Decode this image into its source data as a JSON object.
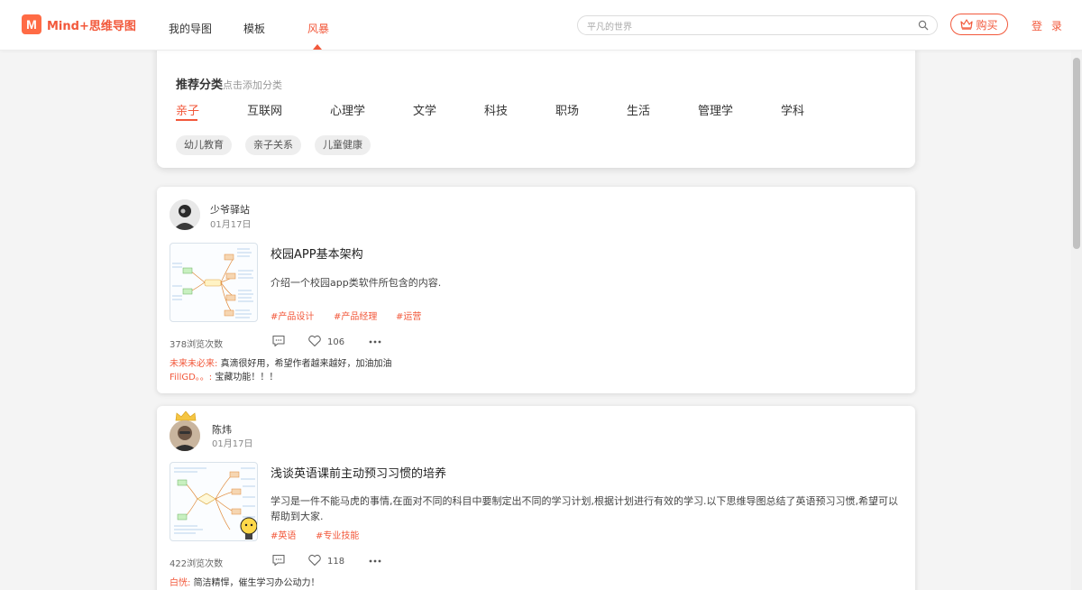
{
  "header": {
    "logo_text": "Mind+思维导图",
    "logo_mark": "M",
    "nav": [
      "我的导图",
      "模板",
      "风暴"
    ],
    "active_nav": "风暴",
    "search_placeholder": "平凡的世界",
    "buy_label": "购买",
    "login_label": "登 录",
    "brand_color": "#f2583b"
  },
  "categories": {
    "title": "推荐分类",
    "hint": "点击添加分类",
    "tabs": [
      "亲子",
      "互联网",
      "心理学",
      "文学",
      "科技",
      "职场",
      "生活",
      "管理学",
      "学科"
    ],
    "active_tab": "亲子",
    "sub_tags": [
      "幼儿教育",
      "亲子关系",
      "儿童健康"
    ]
  },
  "posts": [
    {
      "author": "少爷驿站",
      "date": "01月17日",
      "title": "校园APP基本架构",
      "description": "介绍一个校园app类软件所包含的内容.",
      "tags": [
        "#产品设计",
        "#产品经理",
        "#运营"
      ],
      "views": "378浏览次数",
      "likes": "106",
      "comments": [
        {
          "user": "未来未必来:",
          "text": "真滴很好用，希望作者越来越好，加油加油"
        },
        {
          "user": "FillGD。。:",
          "text": "宝藏功能！！！"
        }
      ]
    },
    {
      "author": "陈炜",
      "date": "01月17日",
      "title": "浅谈英语课前主动预习习惯的培养",
      "description": "学习是一件不能马虎的事情,在面对不同的科目中要制定出不同的学习计划,根据计划进行有效的学习.以下思维导图总结了英语预习习惯,希望可以帮助到大家.",
      "tags": [
        "#英语",
        "#专业技能"
      ],
      "views": "422浏览次数",
      "likes": "118",
      "comments": [
        {
          "user": "白恍:",
          "text": "简洁精悍，催生学习办公动力！"
        }
      ]
    }
  ]
}
